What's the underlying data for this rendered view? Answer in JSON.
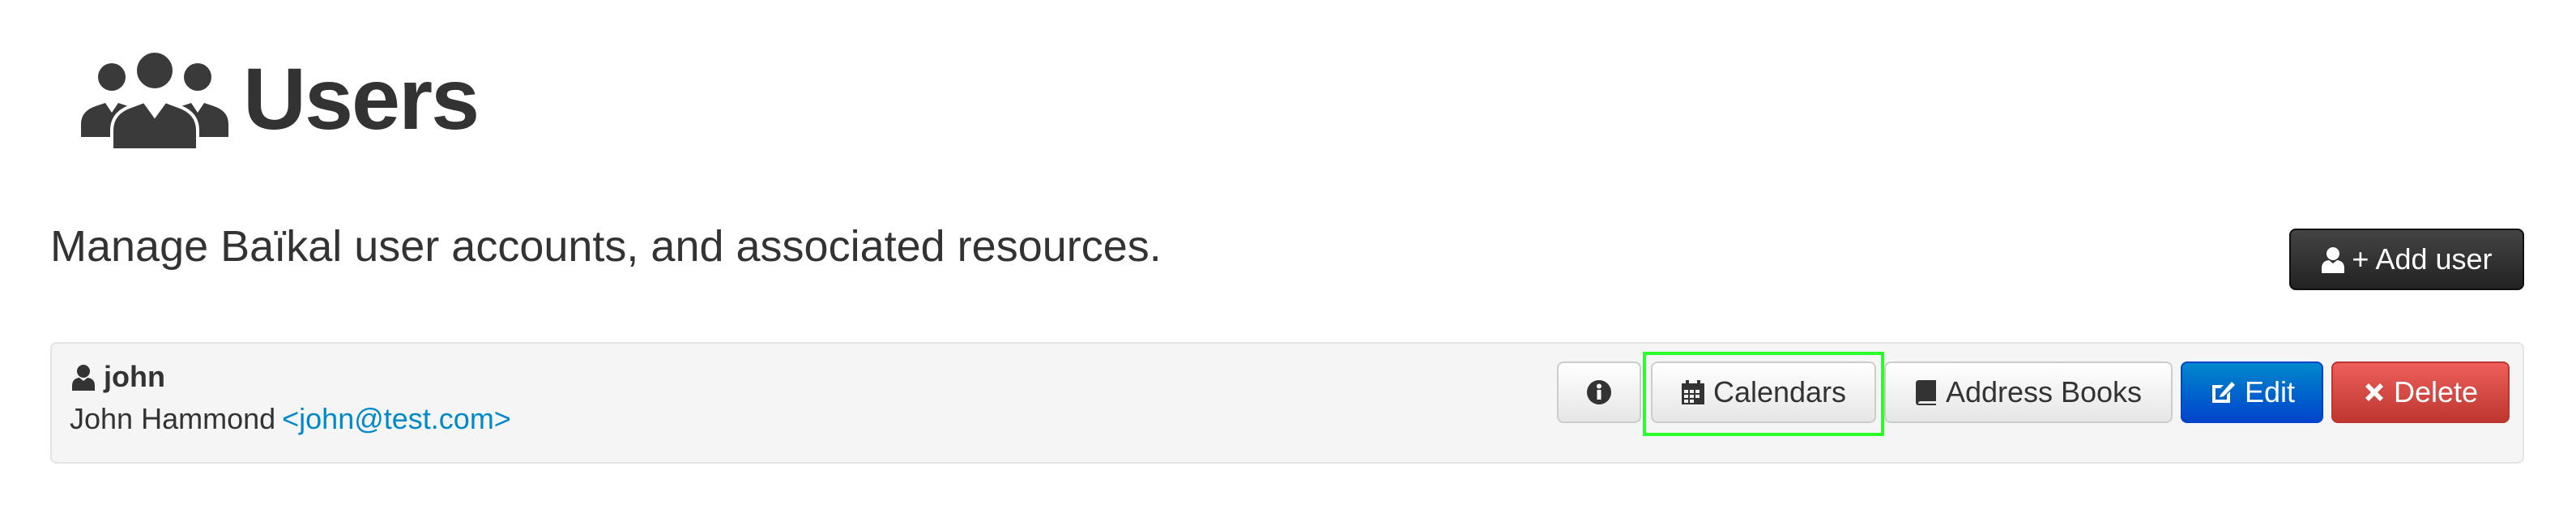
{
  "header": {
    "icon": "users-group-icon",
    "title": "Users"
  },
  "lead": "Manage Baïkal user accounts, and associated resources.",
  "add_user": {
    "label": "+ Add user",
    "icon": "user-icon"
  },
  "users": [
    {
      "username": "john",
      "display_name": "John Hammond",
      "email": "<john@test.com>",
      "actions": {
        "info_icon": "info-icon",
        "calendars": "Calendars",
        "address_books": "Address Books",
        "edit": "Edit",
        "delete": "Delete"
      }
    }
  ],
  "colors": {
    "primary": "#0044cc",
    "danger": "#bd362f",
    "link": "#0088cc",
    "highlight": "#2bff2b"
  }
}
